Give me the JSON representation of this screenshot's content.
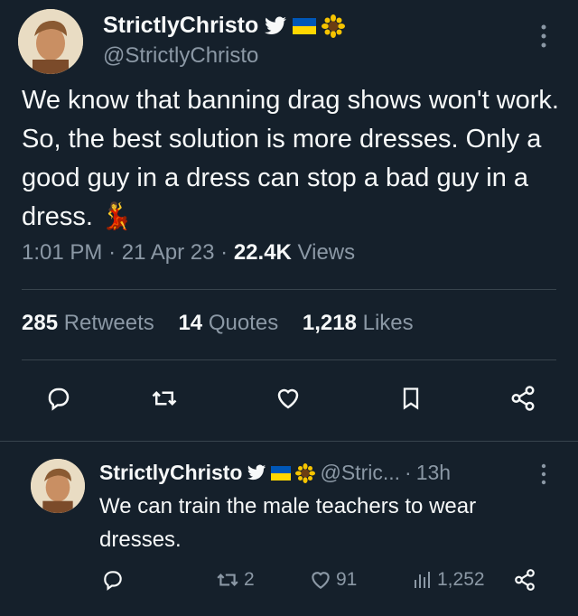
{
  "main_tweet": {
    "display_name": "StrictlyChristo",
    "handle": "@StrictlyChristo",
    "text": "We know that banning drag shows won't work. So, the best solution is more dresses. Only a good guy in a dress can stop a bad guy in a dress.",
    "emoji": "💃",
    "time": "1:01 PM",
    "date": "21 Apr 23",
    "views_count": "22.4K",
    "views_label": "Views",
    "retweets_count": "285",
    "retweets_label": "Retweets",
    "quotes_count": "14",
    "quotes_label": "Quotes",
    "likes_count": "1,218",
    "likes_label": "Likes"
  },
  "reply_tweet": {
    "display_name": "StrictlyChristo",
    "handle": "@Stric...",
    "time_ago": "13h",
    "text": "We can train the male teachers to wear dresses.",
    "retweets": "2",
    "likes": "91",
    "views": "1,252"
  },
  "icons": {
    "verified": "twitter-bird-icon",
    "flag": "ukraine-flag-icon",
    "sunflower": "sunflower-icon",
    "reply": "reply-icon",
    "retweet": "retweet-icon",
    "like": "heart-icon",
    "bookmark": "bookmark-icon",
    "share": "share-icon",
    "views": "views-icon"
  },
  "colors": {
    "background": "#15202b",
    "text": "#f7f9f9",
    "muted": "#8b98a5",
    "divider": "#38444d",
    "flag_blue": "#0057b7",
    "flag_yellow": "#ffd700"
  }
}
